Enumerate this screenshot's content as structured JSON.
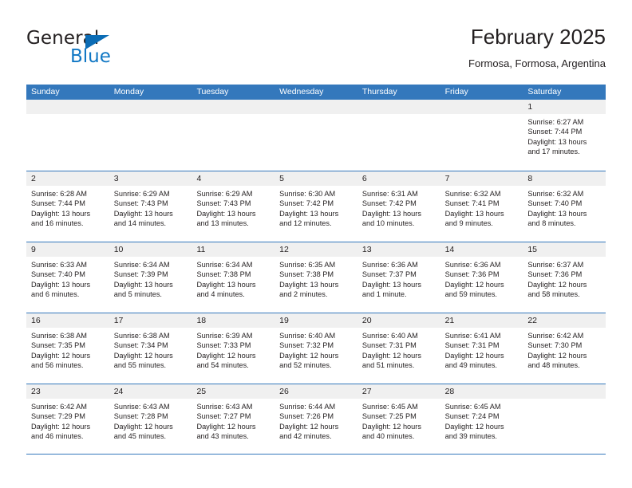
{
  "brand": {
    "name_top": "General",
    "name_bottom": "Blue",
    "accent_color": "#1077c4",
    "triangle_color": "#0b6cb5"
  },
  "header": {
    "title": "February 2025",
    "subtitle": "Formosa, Formosa, Argentina"
  },
  "theme": {
    "header_row_bg": "#3478bc",
    "daynum_strip_bg": "#f0f0f0",
    "text_color": "#231f20",
    "grid_line": "#3478bc"
  },
  "weekdays": [
    "Sunday",
    "Monday",
    "Tuesday",
    "Wednesday",
    "Thursday",
    "Friday",
    "Saturday"
  ],
  "weeks": [
    [
      {
        "day": "",
        "sunrise": "",
        "sunset": "",
        "daylight_1": "",
        "daylight_2": ""
      },
      {
        "day": "",
        "sunrise": "",
        "sunset": "",
        "daylight_1": "",
        "daylight_2": ""
      },
      {
        "day": "",
        "sunrise": "",
        "sunset": "",
        "daylight_1": "",
        "daylight_2": ""
      },
      {
        "day": "",
        "sunrise": "",
        "sunset": "",
        "daylight_1": "",
        "daylight_2": ""
      },
      {
        "day": "",
        "sunrise": "",
        "sunset": "",
        "daylight_1": "",
        "daylight_2": ""
      },
      {
        "day": "",
        "sunrise": "",
        "sunset": "",
        "daylight_1": "",
        "daylight_2": ""
      },
      {
        "day": "1",
        "sunrise": "Sunrise: 6:27 AM",
        "sunset": "Sunset: 7:44 PM",
        "daylight_1": "Daylight: 13 hours",
        "daylight_2": "and 17 minutes."
      }
    ],
    [
      {
        "day": "2",
        "sunrise": "Sunrise: 6:28 AM",
        "sunset": "Sunset: 7:44 PM",
        "daylight_1": "Daylight: 13 hours",
        "daylight_2": "and 16 minutes."
      },
      {
        "day": "3",
        "sunrise": "Sunrise: 6:29 AM",
        "sunset": "Sunset: 7:43 PM",
        "daylight_1": "Daylight: 13 hours",
        "daylight_2": "and 14 minutes."
      },
      {
        "day": "4",
        "sunrise": "Sunrise: 6:29 AM",
        "sunset": "Sunset: 7:43 PM",
        "daylight_1": "Daylight: 13 hours",
        "daylight_2": "and 13 minutes."
      },
      {
        "day": "5",
        "sunrise": "Sunrise: 6:30 AM",
        "sunset": "Sunset: 7:42 PM",
        "daylight_1": "Daylight: 13 hours",
        "daylight_2": "and 12 minutes."
      },
      {
        "day": "6",
        "sunrise": "Sunrise: 6:31 AM",
        "sunset": "Sunset: 7:42 PM",
        "daylight_1": "Daylight: 13 hours",
        "daylight_2": "and 10 minutes."
      },
      {
        "day": "7",
        "sunrise": "Sunrise: 6:32 AM",
        "sunset": "Sunset: 7:41 PM",
        "daylight_1": "Daylight: 13 hours",
        "daylight_2": "and 9 minutes."
      },
      {
        "day": "8",
        "sunrise": "Sunrise: 6:32 AM",
        "sunset": "Sunset: 7:40 PM",
        "daylight_1": "Daylight: 13 hours",
        "daylight_2": "and 8 minutes."
      }
    ],
    [
      {
        "day": "9",
        "sunrise": "Sunrise: 6:33 AM",
        "sunset": "Sunset: 7:40 PM",
        "daylight_1": "Daylight: 13 hours",
        "daylight_2": "and 6 minutes."
      },
      {
        "day": "10",
        "sunrise": "Sunrise: 6:34 AM",
        "sunset": "Sunset: 7:39 PM",
        "daylight_1": "Daylight: 13 hours",
        "daylight_2": "and 5 minutes."
      },
      {
        "day": "11",
        "sunrise": "Sunrise: 6:34 AM",
        "sunset": "Sunset: 7:38 PM",
        "daylight_1": "Daylight: 13 hours",
        "daylight_2": "and 4 minutes."
      },
      {
        "day": "12",
        "sunrise": "Sunrise: 6:35 AM",
        "sunset": "Sunset: 7:38 PM",
        "daylight_1": "Daylight: 13 hours",
        "daylight_2": "and 2 minutes."
      },
      {
        "day": "13",
        "sunrise": "Sunrise: 6:36 AM",
        "sunset": "Sunset: 7:37 PM",
        "daylight_1": "Daylight: 13 hours",
        "daylight_2": "and 1 minute."
      },
      {
        "day": "14",
        "sunrise": "Sunrise: 6:36 AM",
        "sunset": "Sunset: 7:36 PM",
        "daylight_1": "Daylight: 12 hours",
        "daylight_2": "and 59 minutes."
      },
      {
        "day": "15",
        "sunrise": "Sunrise: 6:37 AM",
        "sunset": "Sunset: 7:36 PM",
        "daylight_1": "Daylight: 12 hours",
        "daylight_2": "and 58 minutes."
      }
    ],
    [
      {
        "day": "16",
        "sunrise": "Sunrise: 6:38 AM",
        "sunset": "Sunset: 7:35 PM",
        "daylight_1": "Daylight: 12 hours",
        "daylight_2": "and 56 minutes."
      },
      {
        "day": "17",
        "sunrise": "Sunrise: 6:38 AM",
        "sunset": "Sunset: 7:34 PM",
        "daylight_1": "Daylight: 12 hours",
        "daylight_2": "and 55 minutes."
      },
      {
        "day": "18",
        "sunrise": "Sunrise: 6:39 AM",
        "sunset": "Sunset: 7:33 PM",
        "daylight_1": "Daylight: 12 hours",
        "daylight_2": "and 54 minutes."
      },
      {
        "day": "19",
        "sunrise": "Sunrise: 6:40 AM",
        "sunset": "Sunset: 7:32 PM",
        "daylight_1": "Daylight: 12 hours",
        "daylight_2": "and 52 minutes."
      },
      {
        "day": "20",
        "sunrise": "Sunrise: 6:40 AM",
        "sunset": "Sunset: 7:31 PM",
        "daylight_1": "Daylight: 12 hours",
        "daylight_2": "and 51 minutes."
      },
      {
        "day": "21",
        "sunrise": "Sunrise: 6:41 AM",
        "sunset": "Sunset: 7:31 PM",
        "daylight_1": "Daylight: 12 hours",
        "daylight_2": "and 49 minutes."
      },
      {
        "day": "22",
        "sunrise": "Sunrise: 6:42 AM",
        "sunset": "Sunset: 7:30 PM",
        "daylight_1": "Daylight: 12 hours",
        "daylight_2": "and 48 minutes."
      }
    ],
    [
      {
        "day": "23",
        "sunrise": "Sunrise: 6:42 AM",
        "sunset": "Sunset: 7:29 PM",
        "daylight_1": "Daylight: 12 hours",
        "daylight_2": "and 46 minutes."
      },
      {
        "day": "24",
        "sunrise": "Sunrise: 6:43 AM",
        "sunset": "Sunset: 7:28 PM",
        "daylight_1": "Daylight: 12 hours",
        "daylight_2": "and 45 minutes."
      },
      {
        "day": "25",
        "sunrise": "Sunrise: 6:43 AM",
        "sunset": "Sunset: 7:27 PM",
        "daylight_1": "Daylight: 12 hours",
        "daylight_2": "and 43 minutes."
      },
      {
        "day": "26",
        "sunrise": "Sunrise: 6:44 AM",
        "sunset": "Sunset: 7:26 PM",
        "daylight_1": "Daylight: 12 hours",
        "daylight_2": "and 42 minutes."
      },
      {
        "day": "27",
        "sunrise": "Sunrise: 6:45 AM",
        "sunset": "Sunset: 7:25 PM",
        "daylight_1": "Daylight: 12 hours",
        "daylight_2": "and 40 minutes."
      },
      {
        "day": "28",
        "sunrise": "Sunrise: 6:45 AM",
        "sunset": "Sunset: 7:24 PM",
        "daylight_1": "Daylight: 12 hours",
        "daylight_2": "and 39 minutes."
      },
      {
        "day": "",
        "sunrise": "",
        "sunset": "",
        "daylight_1": "",
        "daylight_2": ""
      }
    ]
  ]
}
